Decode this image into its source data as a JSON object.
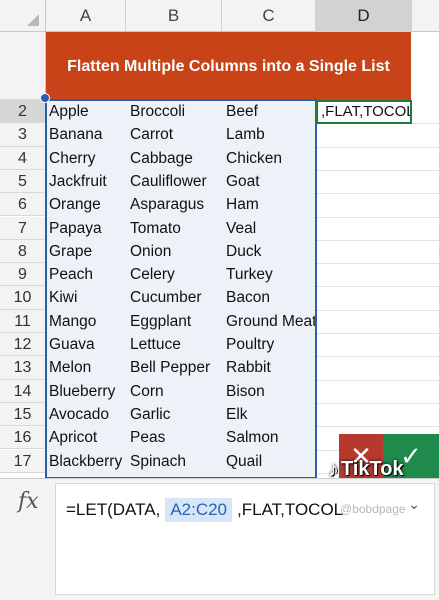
{
  "sheet": {
    "columns": [
      "A",
      "B",
      "C",
      "D"
    ],
    "selected_column": "D",
    "rows": [
      "2",
      "3",
      "4",
      "5",
      "6",
      "7",
      "8",
      "9",
      "10",
      "11",
      "12",
      "13",
      "14",
      "15",
      "16",
      "17"
    ],
    "active_row": "2",
    "title": "Flatten Multiple Columns into a Single List",
    "data": [
      [
        "Apple",
        "Broccoli",
        "Beef"
      ],
      [
        "Banana",
        "Carrot",
        "Lamb"
      ],
      [
        "Cherry",
        "Cabbage",
        "Chicken"
      ],
      [
        "Jackfruit",
        "Cauliflower",
        "Goat"
      ],
      [
        "Orange",
        "Asparagus",
        "Ham"
      ],
      [
        "Papaya",
        "Tomato",
        "Veal"
      ],
      [
        "Grape",
        "Onion",
        "Duck"
      ],
      [
        "Peach",
        "Celery",
        "Turkey"
      ],
      [
        "Kiwi",
        "Cucumber",
        "Bacon"
      ],
      [
        "Mango",
        "Eggplant",
        "Ground Meat"
      ],
      [
        "Guava",
        "Lettuce",
        "Poultry"
      ],
      [
        "Melon",
        "Bell Pepper",
        "Rabbit"
      ],
      [
        "Blueberry",
        "Corn",
        "Bison"
      ],
      [
        "Avocado",
        "Garlic",
        "Elk"
      ],
      [
        "Apricot",
        "Peas",
        "Salmon"
      ],
      [
        "Blackberry",
        "Spinach",
        "Quail"
      ]
    ],
    "active_cell_text": ",FLAT,TOCOL"
  },
  "overlay": {
    "cancel_glyph": "✕",
    "confirm_glyph": "✓",
    "watermark_logo": "♪",
    "watermark_text": "TikTok"
  },
  "formula_bar": {
    "fx_label": "fx",
    "prefix": "=LET(DATA,",
    "reference": "A2:C20",
    "suffix": ",FLAT,TOCOL",
    "handle": "@bobdpage",
    "expand_glyph": "⌄"
  },
  "colors": {
    "banner": "#c84317",
    "selection": "#2a5fb0",
    "active_cell": "#1a7d3a",
    "cancel": "#b5392d",
    "confirm": "#1e8a4c"
  }
}
